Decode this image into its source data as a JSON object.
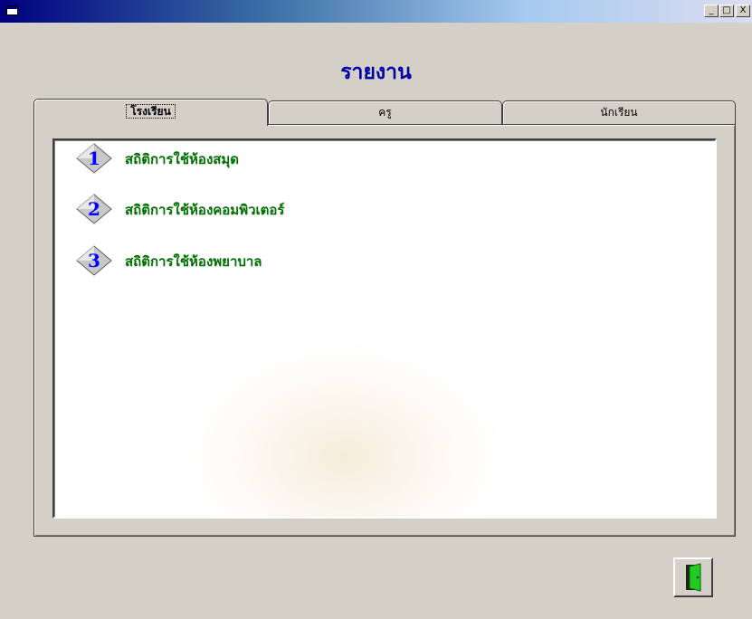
{
  "window": {
    "minimize_glyph": "_",
    "maximize_glyph": "□",
    "close_glyph": "X"
  },
  "heading": "รายงาน",
  "tabs": [
    {
      "label": "โรงเรียน",
      "active": true
    },
    {
      "label": "ครู",
      "active": false
    },
    {
      "label": "นักเรียน",
      "active": false
    }
  ],
  "report_items": [
    {
      "number": "1",
      "label": "สถิติการใช้ห้องสมุด"
    },
    {
      "number": "2",
      "label": "สถิติการใช้ห้องคอมพิวเตอร์"
    },
    {
      "number": "3",
      "label": "สถิติการใช้ห้องพยาบาล"
    }
  ],
  "icons": {
    "app": "window-icon",
    "item_marker": "diamond-number-icon",
    "exit": "exit-door-icon"
  },
  "colors": {
    "title_gradient_start": "#000080",
    "heading": "#0000a8",
    "item_text": "#007000",
    "item_number": "#0000ff",
    "exit_door": "#22cc22"
  }
}
